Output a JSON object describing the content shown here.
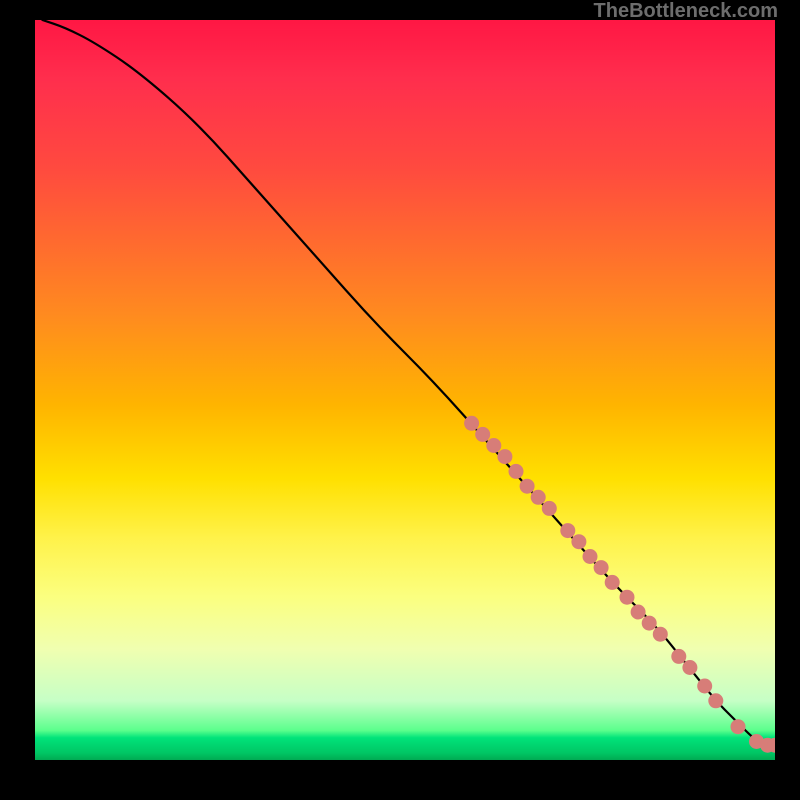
{
  "attribution": "TheBottleneck.com",
  "colors": {
    "background": "#000000",
    "dot": "#d77d78",
    "line": "#000000",
    "gradient_top": "#ff1744",
    "gradient_bottom": "#00aa53"
  },
  "chart_data": {
    "type": "line",
    "title": "",
    "xlabel": "",
    "ylabel": "",
    "xlim": [
      0,
      100
    ],
    "ylim": [
      0,
      100
    ],
    "grid": false,
    "series": [
      {
        "name": "bottleneck-curve",
        "x": [
          1,
          4,
          8,
          14,
          22,
          30,
          38,
          46,
          54,
          62,
          70,
          78,
          84,
          88,
          92,
          95,
          97,
          98.5,
          100
        ],
        "y": [
          100,
          99,
          97,
          93,
          86,
          77,
          68,
          59,
          51,
          42,
          33,
          24,
          18,
          13,
          8,
          5,
          3,
          2,
          2
        ]
      }
    ],
    "scatter_points": [
      {
        "x": 59,
        "y": 45.5
      },
      {
        "x": 60.5,
        "y": 44
      },
      {
        "x": 62,
        "y": 42.5
      },
      {
        "x": 63.5,
        "y": 41
      },
      {
        "x": 65,
        "y": 39
      },
      {
        "x": 66.5,
        "y": 37
      },
      {
        "x": 68,
        "y": 35.5
      },
      {
        "x": 69.5,
        "y": 34
      },
      {
        "x": 72,
        "y": 31
      },
      {
        "x": 73.5,
        "y": 29.5
      },
      {
        "x": 75,
        "y": 27.5
      },
      {
        "x": 76.5,
        "y": 26
      },
      {
        "x": 78,
        "y": 24
      },
      {
        "x": 80,
        "y": 22
      },
      {
        "x": 81.5,
        "y": 20
      },
      {
        "x": 83,
        "y": 18.5
      },
      {
        "x": 84.5,
        "y": 17
      },
      {
        "x": 87,
        "y": 14
      },
      {
        "x": 88.5,
        "y": 12.5
      },
      {
        "x": 90.5,
        "y": 10
      },
      {
        "x": 92,
        "y": 8
      },
      {
        "x": 95,
        "y": 4.5
      },
      {
        "x": 97.5,
        "y": 2.5
      },
      {
        "x": 99,
        "y": 2
      },
      {
        "x": 100,
        "y": 2
      }
    ]
  }
}
